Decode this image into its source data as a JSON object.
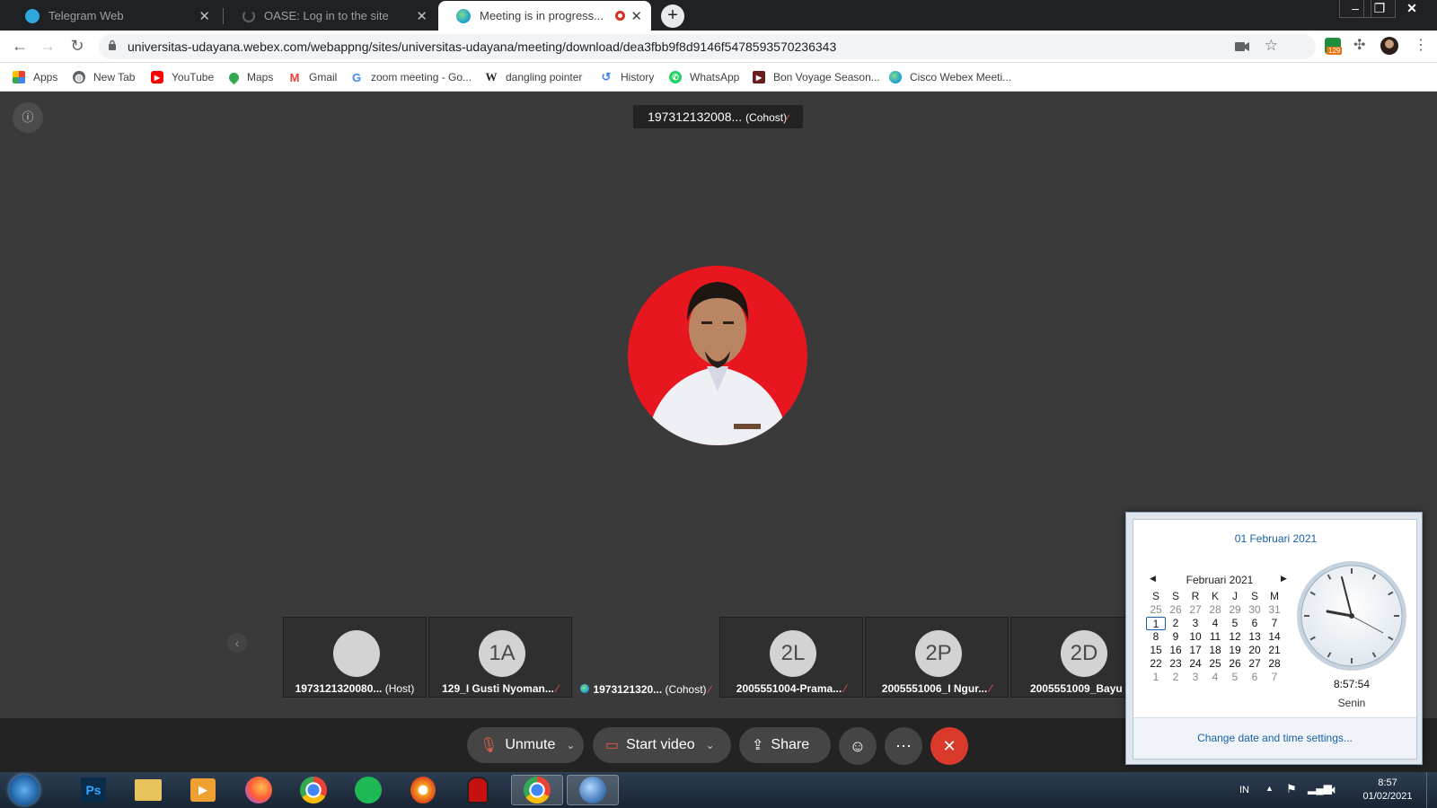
{
  "browser": {
    "tabs": [
      {
        "title": "Telegram Web",
        "icon": "telegram-icon"
      },
      {
        "title": "OASE: Log in to the site",
        "icon": "loading-spinner-icon"
      },
      {
        "title": "Meeting is in progress...",
        "icon": "webex-icon",
        "recording": true
      }
    ],
    "url": "universitas-udayana.webex.com/webappng/sites/universitas-udayana/meeting/download/dea3fbb9f8d9146f5478593570236343",
    "extension_badge": "129",
    "bookmarks": [
      {
        "label": "Apps",
        "icon": "apps-grid-icon"
      },
      {
        "label": "New Tab",
        "icon": "globe-icon"
      },
      {
        "label": "YouTube",
        "icon": "youtube-icon"
      },
      {
        "label": "Maps",
        "icon": "maps-pin-icon"
      },
      {
        "label": "Gmail",
        "icon": "gmail-icon"
      },
      {
        "label": "zoom meeting - Go...",
        "icon": "google-icon"
      },
      {
        "label": "dangling pointer",
        "icon": "wikipedia-icon"
      },
      {
        "label": "History",
        "icon": "history-icon"
      },
      {
        "label": "WhatsApp",
        "icon": "whatsapp-icon"
      },
      {
        "label": "Bon Voyage Season...",
        "icon": "video-icon"
      },
      {
        "label": "Cisco Webex Meeti...",
        "icon": "webex-icon"
      }
    ]
  },
  "meeting": {
    "active_speaker": "197312132008...",
    "active_speaker_role": "(Cohost)",
    "participants": [
      {
        "initials": "",
        "name": "1973121320080...",
        "role": "(Host)"
      },
      {
        "initials": "1A",
        "name": "129_I Gusti Nyoman...",
        "role": ""
      },
      {
        "initials": "",
        "name": "1973121320...",
        "role": "(Cohost)"
      },
      {
        "initials": "2L",
        "name": "2005551004-Prama...",
        "role": ""
      },
      {
        "initials": "2P",
        "name": "2005551006_I Ngur...",
        "role": ""
      },
      {
        "initials": "2D",
        "name": "2005551009_Bayu ...",
        "role": ""
      }
    ],
    "controls": {
      "unmute": "Unmute",
      "start_video": "Start video",
      "share": "Share"
    }
  },
  "calendar": {
    "long_date": "01 Februari 2021",
    "month_label": "Februari 2021",
    "weekdays": [
      "S",
      "S",
      "R",
      "K",
      "J",
      "S",
      "M"
    ],
    "weeks": [
      [
        "25",
        "26",
        "27",
        "28",
        "29",
        "30",
        "31"
      ],
      [
        "1",
        "2",
        "3",
        "4",
        "5",
        "6",
        "7"
      ],
      [
        "8",
        "9",
        "10",
        "11",
        "12",
        "13",
        "14"
      ],
      [
        "15",
        "16",
        "17",
        "18",
        "19",
        "20",
        "21"
      ],
      [
        "22",
        "23",
        "24",
        "25",
        "26",
        "27",
        "28"
      ],
      [
        "1",
        "2",
        "3",
        "4",
        "5",
        "6",
        "7"
      ]
    ],
    "time": "8:57:54",
    "day_name": "Senin",
    "settings_link": "Change date and time settings..."
  },
  "taskbar": {
    "language": "IN",
    "clock_time": "8:57",
    "clock_date": "01/02/2021",
    "apps": [
      "windows-start-icon",
      "photoshop-icon",
      "file-explorer-icon",
      "media-player-icon",
      "firefox-icon",
      "chrome-icon",
      "spotify-icon",
      "brave-icon",
      "among-us-icon",
      "chrome-icon",
      "webex-icon"
    ]
  }
}
